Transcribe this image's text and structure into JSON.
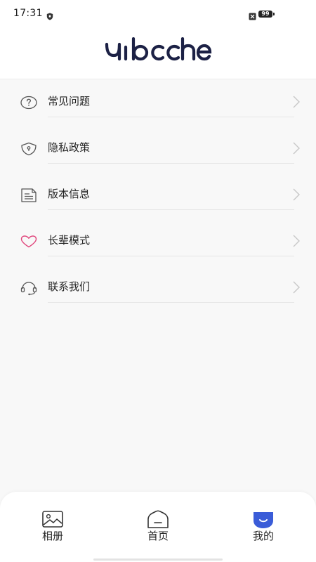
{
  "status_bar": {
    "time": "17:31",
    "battery": "99"
  },
  "header": {
    "logo_text": "yiboche"
  },
  "menu": {
    "items": [
      {
        "label": "常见问题",
        "icon": "question-circle-icon"
      },
      {
        "label": "隐私政策",
        "icon": "shield-icon"
      },
      {
        "label": "版本信息",
        "icon": "document-icon"
      },
      {
        "label": "长辈模式",
        "icon": "heart-icon"
      },
      {
        "label": "联系我们",
        "icon": "headset-icon"
      }
    ]
  },
  "tabbar": {
    "tabs": [
      {
        "label": "相册",
        "icon": "photo-album-icon",
        "active": false
      },
      {
        "label": "首页",
        "icon": "home-icon",
        "active": false
      },
      {
        "label": "我的",
        "icon": "profile-icon",
        "active": true
      }
    ]
  },
  "colors": {
    "accent": "#3a5cd8",
    "heart": "#e0457b",
    "logo": "#1c2145"
  }
}
